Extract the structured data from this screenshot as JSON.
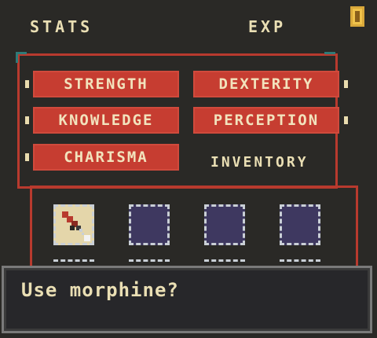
{
  "header": {
    "stats_tab": "STATS",
    "exp_tab": "EXP"
  },
  "stats": {
    "buttons": [
      {
        "label": "STRENGTH"
      },
      {
        "label": "DEXTERITY"
      },
      {
        "label": "KNOWLEDGE"
      },
      {
        "label": "PERCEPTION"
      },
      {
        "label": "CHARISMA"
      }
    ]
  },
  "inventory": {
    "label": "INVENTORY",
    "slots": [
      {
        "item_icon": "morphine-syringe-icon"
      },
      {
        "item_icon": "empty-slot"
      },
      {
        "item_icon": "empty-slot"
      },
      {
        "item_icon": "empty-slot"
      }
    ]
  },
  "dialog": {
    "text": "Use morphine?"
  },
  "icons": {
    "corner": "exit-door-icon"
  },
  "colors": {
    "background": "#2a2926",
    "stat_button": "#c63d31",
    "frame": "#b83a2e",
    "slot_empty": "#3e3860",
    "text": "#eadfb4"
  }
}
